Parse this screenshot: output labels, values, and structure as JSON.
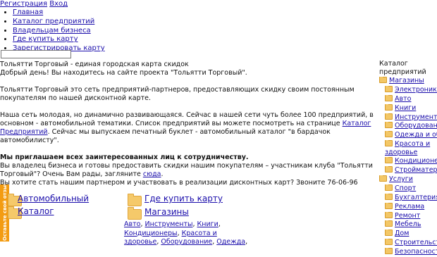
{
  "top": {
    "register": "Регистрация",
    "login": "Вход"
  },
  "nav": [
    "Главная",
    "Каталог предприятий",
    "Владельцам бизнеса",
    "Где купить карту",
    "Зарегистрировать карту"
  ],
  "search": {
    "value": ""
  },
  "main": {
    "title": "Тольятти Торговый - единая городская карта скидок",
    "greeting": "Добрый день! Вы находитесь на сайте проекта \"Тольятти Торговый\".",
    "p1": "Тольятти Торговый это  сеть предприятий-партнеров, предоставляющих скидку своим постоянным покупателям по нашей дисконтной карте.",
    "p2_a": "Наша сеть молодая, но динамично развивающаяся. Сейчас в нашей сети чуть более 100 предприятий, в основном - автомобильной тематики. Список предприятий вы можете посмотреть на странице ",
    "p2_link": "Каталог Предприятий",
    "p2_b": ". Сейчас мы выпускаем печатный буклет - автомобильный каталог \"в бардачок автомобилисту\".",
    "invite": "Мы приглашаем всех заинтересованных лиц к сотрудничеству.",
    "p3_a": "Вы владелец бизнеса и готовы предоставить скидки нашим покупателям – участникам клуба \"Тольятти Торговый\"? Очень Вам рады, загляните ",
    "p3_link": "сюда",
    "p3_b": ".",
    "p4": "Вы хотите стать нашим партнером и участвовать в реализации дисконтных карт? Звоните 76-06-96"
  },
  "catalog": {
    "title": "Каталог предприятий",
    "shops": {
      "label": "Магазины",
      "items": [
        "Электроника",
        "Авто",
        "Книги",
        "Инструменты",
        "Оборудование",
        "Одежда и обувь",
        "Красота и здоровье",
        "Кондиционеры",
        "Стройматериалы"
      ]
    },
    "services": {
      "label": "Услуги",
      "items": [
        "Спорт",
        "Бухгалтерия",
        "Реклама",
        "Ремонт",
        "Мебель",
        "Дом",
        "Строительство",
        "Безопасность"
      ]
    }
  },
  "bottom": {
    "strip": "Оставьте свой отзыв",
    "auto": "Автомобильный",
    "catalog": "Каталог",
    "buy": "Где купить карту",
    "shops": "Магазины",
    "shop_links": [
      "Авто",
      "Инструменты",
      "Книги",
      "Кондиционеры",
      "Красота и здоровье",
      "Оборудование",
      "Одежда"
    ]
  }
}
